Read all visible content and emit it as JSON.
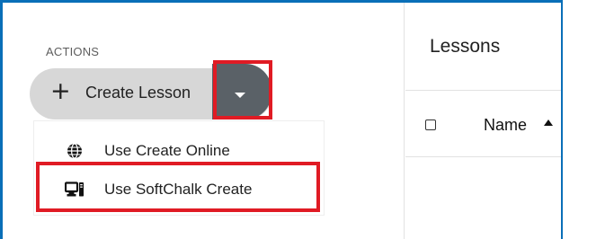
{
  "sidebar": {
    "section_label": "ACTIONS",
    "create_button": {
      "plus_glyph": "+",
      "label": "Create Lesson"
    },
    "dropdown_icon": "caret-down-icon",
    "menu": {
      "items": [
        {
          "label": "Use Create Online",
          "icon": "globe-icon"
        },
        {
          "label": "Use SoftChalk Create",
          "icon": "desktop-icon"
        }
      ]
    }
  },
  "main": {
    "title": "Lessons",
    "table": {
      "columns": [
        {
          "label": "Name",
          "sort": "ascending"
        }
      ]
    }
  },
  "colors": {
    "frame_border": "#0a6fb8",
    "highlight": "#e01b24",
    "button_bg": "#d7d7d7",
    "toggle_bg": "#5a6167"
  }
}
